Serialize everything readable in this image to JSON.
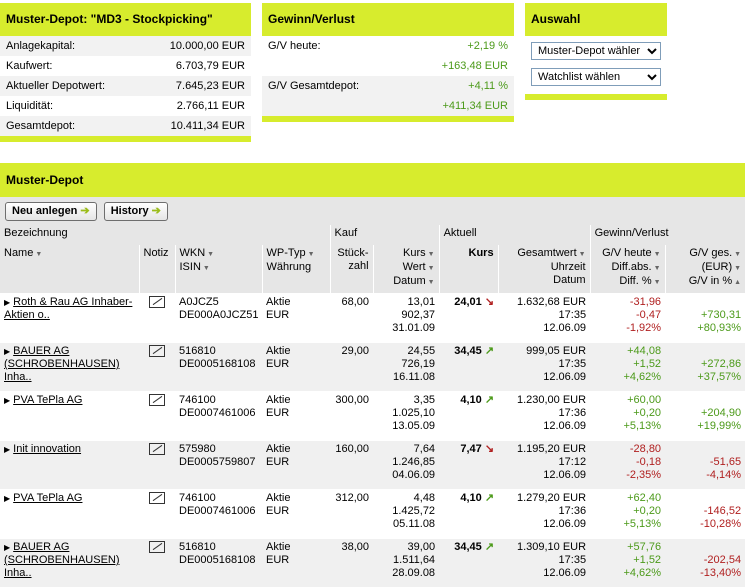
{
  "depot": {
    "title": "Muster-Depot: \"MD3 - Stockpicking\"",
    "rows": [
      {
        "label": "Anlagekapital:",
        "value": "10.000,00 EUR"
      },
      {
        "label": "Kaufwert:",
        "value": "6.703,79 EUR"
      },
      {
        "label": "Aktueller Depotwert:",
        "value": "7.645,23 EUR"
      },
      {
        "label": "Liquidität:",
        "value": "2.766,11 EUR"
      },
      {
        "label": "Gesamtdepot:",
        "value": "10.411,34 EUR"
      }
    ]
  },
  "gv": {
    "title": "Gewinn/Verlust",
    "heute_label": "G/V heute:",
    "heute_pct": "+2,19 %",
    "heute_abs": "+163,48 EUR",
    "gesamt_label": "G/V Gesamtdepot:",
    "gesamt_pct": "+4,11 %",
    "gesamt_abs": "+411,34 EUR"
  },
  "auswahl": {
    "title": "Auswahl",
    "select1": "Muster-Depot wähler",
    "select2": "Watchlist wählen"
  },
  "section": {
    "title": "Muster-Depot",
    "btn_new": "Neu anlegen",
    "btn_history": "History"
  },
  "headers": {
    "bezeichnung": "Bezeichnung",
    "kauf": "Kauf",
    "aktuell": "Aktuell",
    "gv": "Gewinn/Verlust",
    "name": "Name",
    "notiz": "Notiz",
    "wkn": "WKN",
    "isin": "ISIN",
    "wptyp": "WP-Typ",
    "waehrung": "Währung",
    "stueck": "Stück-",
    "zahl": "zahl",
    "kurs": "Kurs",
    "wert": "Wert",
    "datum": "Datum",
    "akt_kurs": "Kurs",
    "gesamtwert": "Gesamtwert",
    "uhrzeit": "Uhrzeit",
    "datum2": "Datum",
    "gvheute": "G/V heute",
    "diffabs": "Diff.abs.",
    "diffpct": "Diff. %",
    "gvges": "G/V ges.",
    "eur": "(EUR)",
    "gvinpct": "G/V in %"
  },
  "rows": [
    {
      "name": "Roth & Rau AG Inhaber-Aktien o..",
      "wkn": "A0JCZ5",
      "isin": "DE000A0JCZ51",
      "typ": "Aktie",
      "cur": "EUR",
      "stk": "68,00",
      "kurs": "13,01",
      "wert": "902,37",
      "datum": "31.01.09",
      "akt": "24,01",
      "trend": "down",
      "gw": "1.632,68 EUR",
      "zeit": "17:35",
      "dat2": "12.06.09",
      "gvh": "-31,96",
      "dabs": "-0,47",
      "dpct": "-1,92%",
      "neg": true,
      "gvg": "+730,31",
      "gvp": "+80,93%",
      "gneg": false
    },
    {
      "name": "BAUER AG (SCHROBENHAUSEN) Inha..",
      "wkn": "516810",
      "isin": "DE0005168108",
      "typ": "Aktie",
      "cur": "EUR",
      "stk": "29,00",
      "kurs": "24,55",
      "wert": "726,19",
      "datum": "16.11.08",
      "akt": "34,45",
      "trend": "up",
      "gw": "999,05 EUR",
      "zeit": "17:35",
      "dat2": "12.06.09",
      "gvh": "+44,08",
      "dabs": "+1,52",
      "dpct": "+4,62%",
      "neg": false,
      "gvg": "+272,86",
      "gvp": "+37,57%",
      "gneg": false
    },
    {
      "name": "PVA TePla AG",
      "wkn": "746100",
      "isin": "DE0007461006",
      "typ": "Aktie",
      "cur": "EUR",
      "stk": "300,00",
      "kurs": "3,35",
      "wert": "1.025,10",
      "datum": "13.05.09",
      "akt": "4,10",
      "trend": "up",
      "gw": "1.230,00 EUR",
      "zeit": "17:36",
      "dat2": "12.06.09",
      "gvh": "+60,00",
      "dabs": "+0,20",
      "dpct": "+5,13%",
      "neg": false,
      "gvg": "+204,90",
      "gvp": "+19,99%",
      "gneg": false
    },
    {
      "name": "Init innovation",
      "wkn": "575980",
      "isin": "DE0005759807",
      "typ": "Aktie",
      "cur": "EUR",
      "stk": "160,00",
      "kurs": "7,64",
      "wert": "1.246,85",
      "datum": "04.06.09",
      "akt": "7,47",
      "trend": "down",
      "gw": "1.195,20 EUR",
      "zeit": "17:12",
      "dat2": "12.06.09",
      "gvh": "-28,80",
      "dabs": "-0,18",
      "dpct": "-2,35%",
      "neg": true,
      "gvg": "-51,65",
      "gvp": "-4,14%",
      "gneg": true
    },
    {
      "name": "PVA TePla AG",
      "wkn": "746100",
      "isin": "DE0007461006",
      "typ": "Aktie",
      "cur": "EUR",
      "stk": "312,00",
      "kurs": "4,48",
      "wert": "1.425,72",
      "datum": "05.11.08",
      "akt": "4,10",
      "trend": "up",
      "gw": "1.279,20 EUR",
      "zeit": "17:36",
      "dat2": "12.06.09",
      "gvh": "+62,40",
      "dabs": "+0,20",
      "dpct": "+5,13%",
      "neg": false,
      "gvg": "-146,52",
      "gvp": "-10,28%",
      "gneg": true
    },
    {
      "name": "BAUER AG (SCHROBENHAUSEN) Inha..",
      "wkn": "516810",
      "isin": "DE0005168108",
      "typ": "Aktie",
      "cur": "EUR",
      "stk": "38,00",
      "kurs": "39,00",
      "wert": "1.511,64",
      "datum": "28.09.08",
      "akt": "34,45",
      "trend": "up",
      "gw": "1.309,10 EUR",
      "zeit": "17:35",
      "dat2": "12.06.09",
      "gvh": "+57,76",
      "dabs": "+1,52",
      "dpct": "+4,62%",
      "neg": false,
      "gvg": "-202,54",
      "gvp": "-13,40%",
      "gneg": true
    }
  ]
}
